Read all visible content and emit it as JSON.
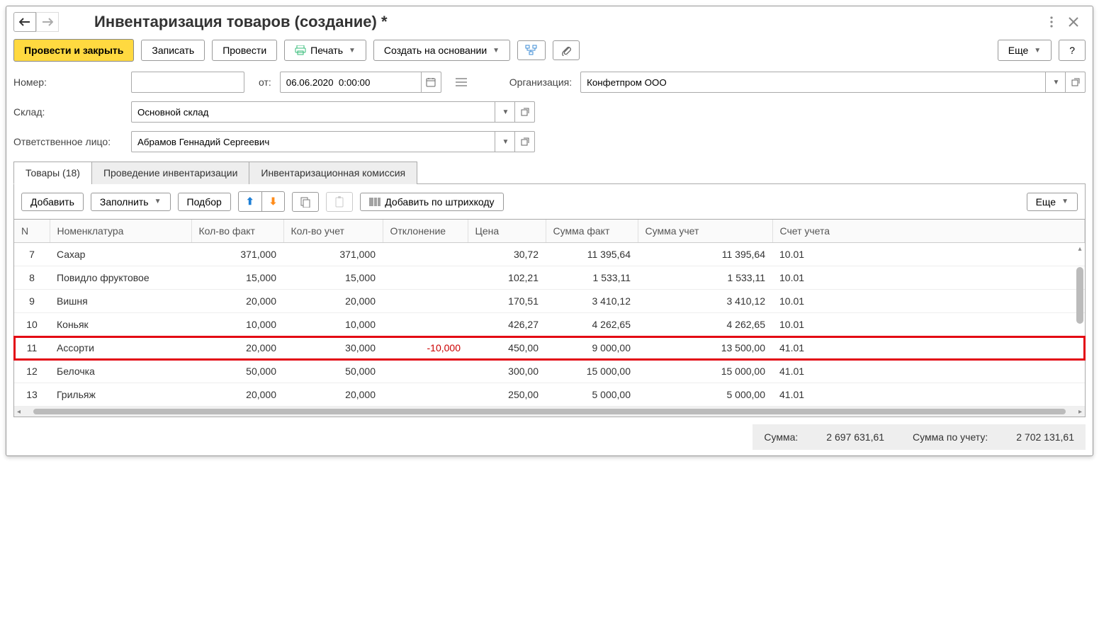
{
  "title": "Инвентаризация товаров (создание) *",
  "toolbar": {
    "post_close": "Провести и закрыть",
    "write": "Записать",
    "post": "Провести",
    "print": "Печать",
    "create_based": "Создать на основании",
    "more": "Еще",
    "help": "?"
  },
  "form": {
    "number_label": "Номер:",
    "number_value": "",
    "from_label": "от:",
    "date_value": "06.06.2020  0:00:00",
    "org_label": "Организация:",
    "org_value": "Конфетпром ООО",
    "warehouse_label": "Склад:",
    "warehouse_value": "Основной склад",
    "responsible_label": "Ответственное лицо:",
    "responsible_value": "Абрамов Геннадий Сергеевич"
  },
  "tabs": {
    "goods": "Товары (18)",
    "conduct": "Проведение инвентаризации",
    "commission": "Инвентаризационная комиссия"
  },
  "tabtoolbar": {
    "add": "Добавить",
    "fill": "Заполнить",
    "pick": "Подбор",
    "addbarcode": "Добавить по штрихкоду",
    "more": "Еще"
  },
  "columns": {
    "n": "N",
    "nomen": "Номенклатура",
    "qty_fact": "Кол-во факт",
    "qty_acc": "Кол-во учет",
    "dev": "Отклонение",
    "price": "Цена",
    "sum_fact": "Сумма факт",
    "sum_acc": "Сумма учет",
    "account": "Счет учета"
  },
  "rows": [
    {
      "n": "7",
      "name": "Сахар",
      "qf": "371,000",
      "qa": "371,000",
      "dev": "",
      "price": "30,72",
      "sf": "11 395,64",
      "sa": "11 395,64",
      "acc": "10.01",
      "hl": false
    },
    {
      "n": "8",
      "name": "Повидло фруктовое",
      "qf": "15,000",
      "qa": "15,000",
      "dev": "",
      "price": "102,21",
      "sf": "1 533,11",
      "sa": "1 533,11",
      "acc": "10.01",
      "hl": false
    },
    {
      "n": "9",
      "name": "Вишня",
      "qf": "20,000",
      "qa": "20,000",
      "dev": "",
      "price": "170,51",
      "sf": "3 410,12",
      "sa": "3 410,12",
      "acc": "10.01",
      "hl": false
    },
    {
      "n": "10",
      "name": "Коньяк",
      "qf": "10,000",
      "qa": "10,000",
      "dev": "",
      "price": "426,27",
      "sf": "4 262,65",
      "sa": "4 262,65",
      "acc": "10.01",
      "hl": false
    },
    {
      "n": "11",
      "name": "Ассорти",
      "qf": "20,000",
      "qa": "30,000",
      "dev": "-10,000",
      "price": "450,00",
      "sf": "9 000,00",
      "sa": "13 500,00",
      "acc": "41.01",
      "hl": true
    },
    {
      "n": "12",
      "name": "Белочка",
      "qf": "50,000",
      "qa": "50,000",
      "dev": "",
      "price": "300,00",
      "sf": "15 000,00",
      "sa": "15 000,00",
      "acc": "41.01",
      "hl": false
    },
    {
      "n": "13",
      "name": "Грильяж",
      "qf": "20,000",
      "qa": "20,000",
      "dev": "",
      "price": "250,00",
      "sf": "5 000,00",
      "sa": "5 000,00",
      "acc": "41.01",
      "hl": false
    }
  ],
  "summary": {
    "sum_label": "Сумма:",
    "sum_value": "2 697 631,61",
    "sum_acc_label": "Сумма по учету:",
    "sum_acc_value": "2 702 131,61"
  }
}
